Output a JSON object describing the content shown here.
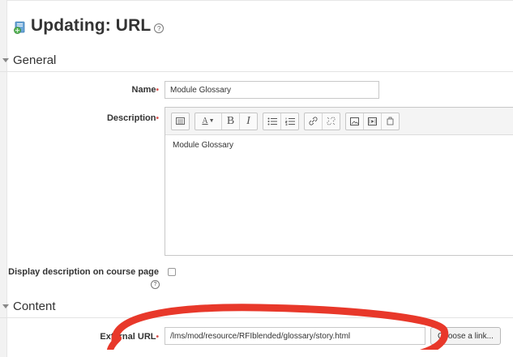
{
  "page": {
    "title": "Updating: URL",
    "help_icon": "help-icon"
  },
  "sections": {
    "general": "General",
    "content": "Content"
  },
  "fields": {
    "name": {
      "label": "Name",
      "value": "Module Glossary"
    },
    "description": {
      "label": "Description",
      "value": "Module Glossary"
    },
    "display_description": {
      "label": "Display description on course page",
      "checked": false
    },
    "external_url": {
      "label": "External URL",
      "value": "/lms/mod/resource/RFIblended/glossary/story.html"
    }
  },
  "required_marker": "•",
  "buttons": {
    "choose_link": "Choose a link..."
  },
  "toolbar": {
    "font_size_label": "A",
    "bold": "B",
    "italic": "I",
    "icons": [
      "toolbar-toggle-icon",
      "font-size-icon",
      "bold-icon",
      "italic-icon",
      "unordered-list-icon",
      "ordered-list-icon",
      "link-icon",
      "unlink-icon",
      "image-icon",
      "media-icon",
      "manage-files-icon"
    ]
  },
  "colors": {
    "required": "#d9534f",
    "annotation_circle": "#e8382a",
    "background": "#f2f2f2"
  }
}
